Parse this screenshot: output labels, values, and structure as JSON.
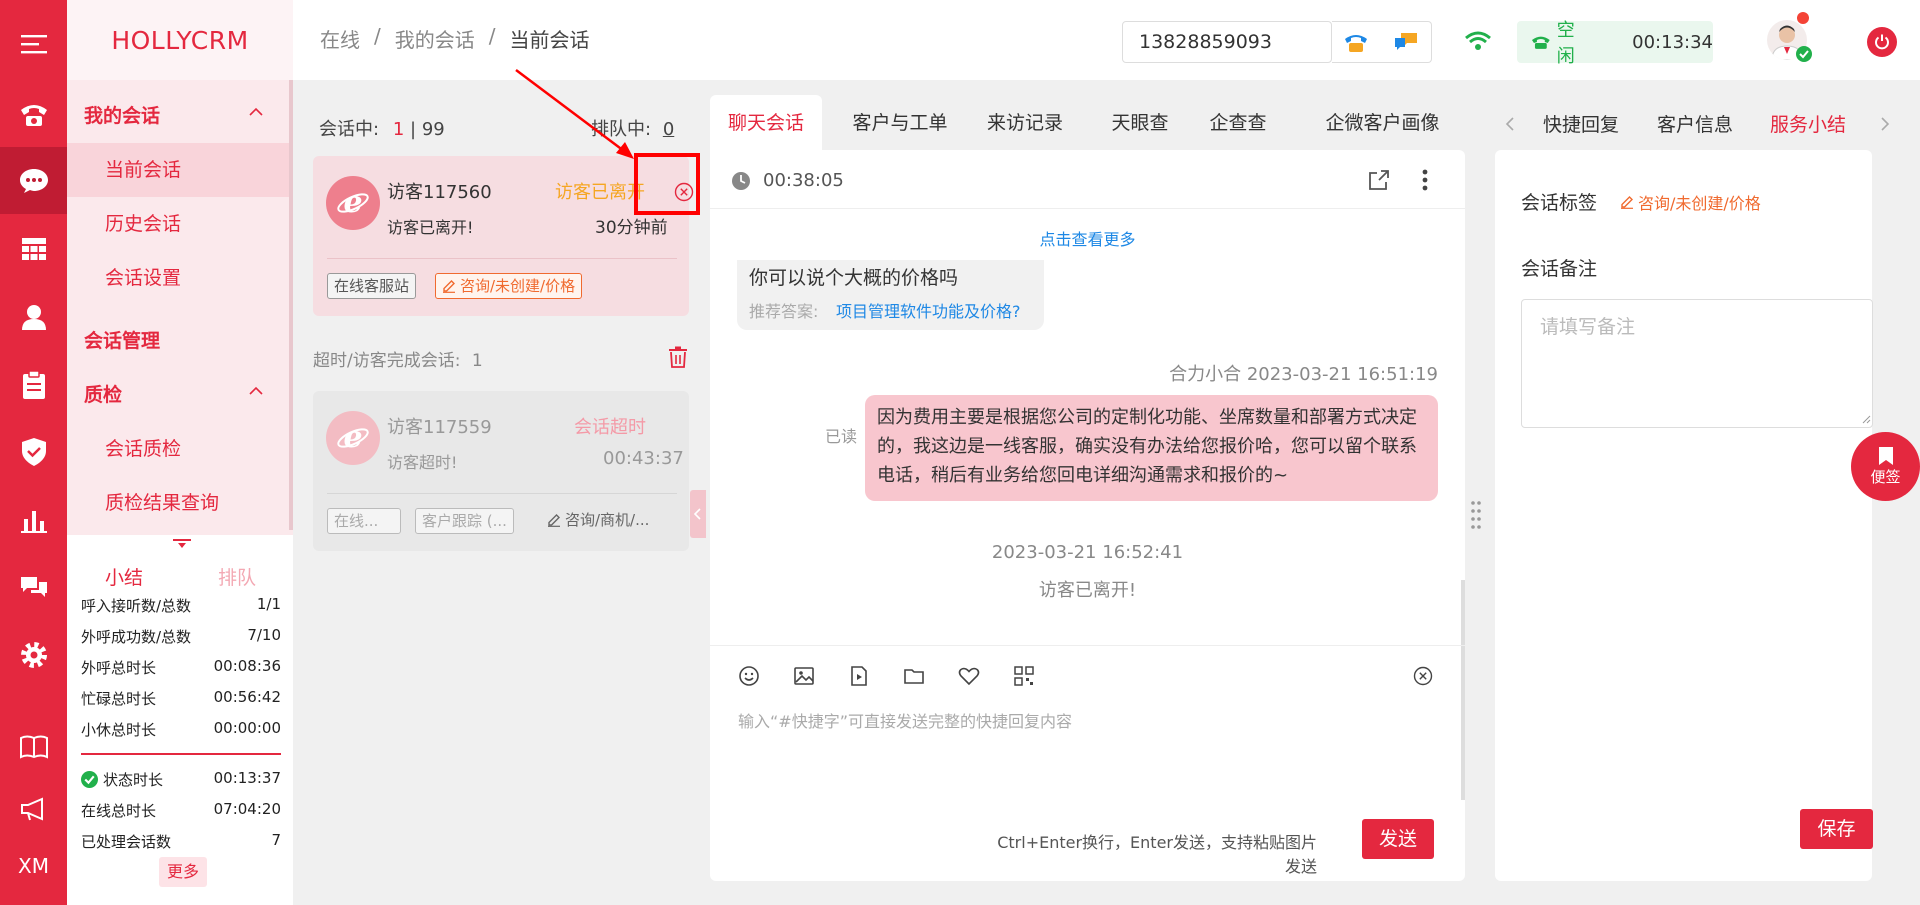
{
  "brand": "HOLLYCRM",
  "rail": {
    "xm_label": "XM"
  },
  "sidebar": {
    "group_my_sessions": "我的会话",
    "items_my_sessions": [
      "当前会话",
      "历史会话",
      "会话设置"
    ],
    "group_session_manage": "会话管理",
    "group_quality": "质检",
    "items_quality": [
      "会话质检",
      "质检结果查询"
    ],
    "tab_summary": "小结",
    "tab_queue": "排队",
    "stats": [
      {
        "label": "呼入接听数/总数",
        "value": "1/1"
      },
      {
        "label": "外呼成功数/总数",
        "value": "7/10"
      },
      {
        "label": "外呼总时长",
        "value": "00:08:36"
      },
      {
        "label": "忙碌总时长",
        "value": "00:56:42"
      },
      {
        "label": "小休总时长",
        "value": "00:00:00"
      }
    ],
    "stats2": [
      {
        "label": "状态时长",
        "value": "00:13:37"
      },
      {
        "label": "在线总时长",
        "value": "07:04:20"
      },
      {
        "label": "已处理会话数",
        "value": "7"
      }
    ],
    "more_label": "更多"
  },
  "header": {
    "breadcrumb": [
      "在线",
      "我的会话",
      "当前会话"
    ],
    "crumb_sep": "/",
    "phone_number": "13828859093",
    "status_label": "空闲",
    "status_timer": "00:13:34"
  },
  "conversations": {
    "in_session_label": "会话中:",
    "in_session_count": "1",
    "in_session_sep": "|",
    "in_session_total": "99",
    "queue_label": "排队中:",
    "queue_count": "0",
    "active": {
      "name": "访客117560",
      "status": "访客已离开",
      "last_msg": "访客已离开!",
      "time": "30分钟前",
      "tag_channel": "在线客服站",
      "tag_category": "咨询/未创建/价格"
    },
    "timeout_label": "超时/访客完成会话:",
    "timeout_count": "1",
    "timeout_item": {
      "name": "访客117559",
      "status": "会话超时",
      "last_msg": "访客超时!",
      "time": "00:43:37",
      "tag_channel": "在线...",
      "tag_follow": "客户跟踪 (...",
      "tag_category": "咨询/商机/..."
    }
  },
  "chat": {
    "tabs": [
      "聊天会话",
      "客户与工单",
      "来访记录",
      "天眼查",
      "企查查",
      "企微客户画像"
    ],
    "timer": "00:38:05",
    "load_more": "点击查看更多",
    "visitor_msg": "你可以说个大概的价格吗",
    "suggest_label": "推荐答案:",
    "suggest_link": "项目管理软件功能及价格?",
    "agent_meta": "合力小合 2023-03-21 16:51:19",
    "read_label": "已读",
    "agent_msg": "因为费用主要是根据您公司的定制化功能、坐席数量和部署方式决定的，我这边是一线客服，确实没有办法给您报价哈，您可以留个联系电话，稍后有业务给您回电详细沟通需求和报价的~",
    "sys_time": "2023-03-21 16:52:41",
    "sys_msg": "访客已离开!",
    "input_placeholder": "输入“#快捷字”可直接发送完整的快捷回复内容",
    "send_hint": "Ctrl+Enter换行，Enter发送，支持粘贴图片发送",
    "send_label": "发送"
  },
  "right": {
    "tabs": [
      "快捷回复",
      "客户信息",
      "服务小结"
    ],
    "tag_label": "会话标签",
    "tag_value": "咨询/未创建/价格",
    "note_label": "会话备注",
    "note_placeholder": "请填写备注",
    "save_label": "保存",
    "sticky_label": "便签"
  },
  "colors": {
    "brand": "#e4283f",
    "idle": "#21b04b",
    "orange": "#f06a2f",
    "link": "#1e88e5"
  },
  "icons": [
    "menu-icon",
    "phone-icon",
    "chat-icon",
    "grid-icon",
    "user-icon",
    "clipboard-icon",
    "shield-icon",
    "bar-chart-icon",
    "comments-icon",
    "gear-icon",
    "book-icon",
    "megaphone-icon",
    "wifi-icon",
    "power-icon",
    "clock-icon",
    "share-icon",
    "more-icon",
    "emoji-icon",
    "image-icon",
    "video-icon",
    "folder-icon",
    "heart-icon",
    "qrcode-icon",
    "close-circle-icon",
    "trash-icon",
    "edit-icon",
    "bookmark-icon"
  ]
}
